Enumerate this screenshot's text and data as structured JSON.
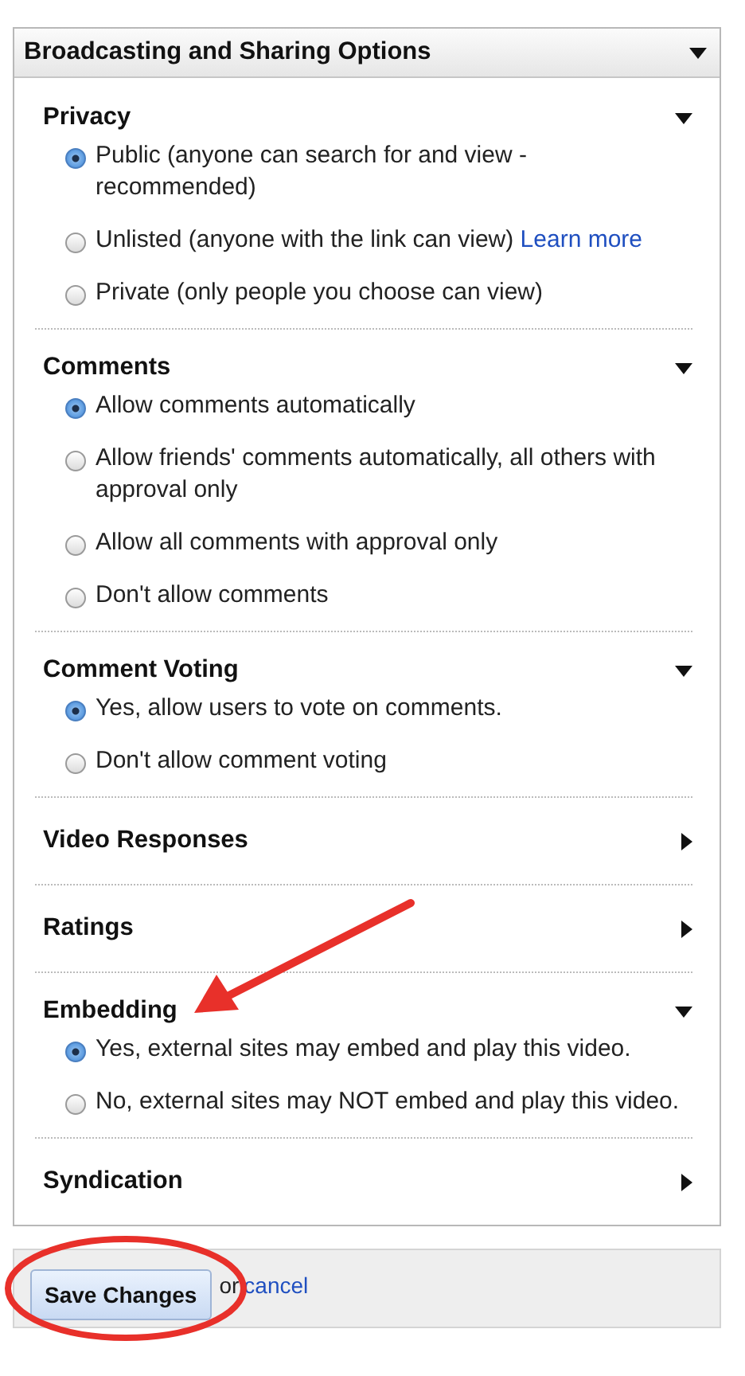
{
  "panel": {
    "title": "Broadcasting and Sharing Options",
    "expanded": true,
    "sections": [
      {
        "title": "Privacy",
        "expanded": true,
        "options": [
          {
            "label": "Public (anyone can search for and view - recommended)",
            "selected": true
          },
          {
            "label": "Unlisted (anyone with the link can view)",
            "link": "Learn more",
            "selected": false
          },
          {
            "label": "Private (only people you choose can view)",
            "selected": false
          }
        ]
      },
      {
        "title": "Comments",
        "expanded": true,
        "options": [
          {
            "label": "Allow comments automatically",
            "selected": true
          },
          {
            "label": "Allow friends' comments automatically, all others with approval only",
            "selected": false
          },
          {
            "label": "Allow all comments with approval only",
            "selected": false
          },
          {
            "label": "Don't allow comments",
            "selected": false
          }
        ]
      },
      {
        "title": "Comment Voting",
        "expanded": true,
        "options": [
          {
            "label": "Yes, allow users to vote on comments.",
            "selected": true
          },
          {
            "label": "Don't allow comment voting",
            "selected": false
          }
        ]
      },
      {
        "title": "Video Responses",
        "expanded": false
      },
      {
        "title": "Ratings",
        "expanded": false
      },
      {
        "title": "Embedding",
        "expanded": true,
        "options": [
          {
            "label": "Yes, external sites may embed and play this video.",
            "selected": true
          },
          {
            "label": "No, external sites may NOT embed and play this video.",
            "selected": false
          }
        ]
      },
      {
        "title": "Syndication",
        "expanded": false
      }
    ]
  },
  "footer": {
    "save_button": "Save Changes",
    "separator": "or",
    "cancel_link": "cancel"
  }
}
